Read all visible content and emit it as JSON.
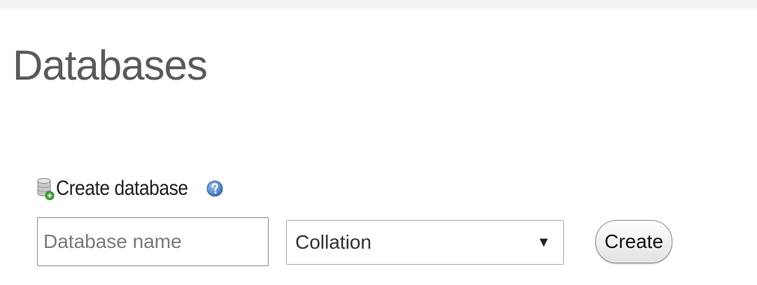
{
  "page": {
    "title": "Databases"
  },
  "create_section": {
    "heading": "Create database",
    "db_icon": "database-add-icon",
    "help_icon": "help-icon"
  },
  "form": {
    "name_input": {
      "value": "",
      "placeholder": "Database name"
    },
    "collation_select": {
      "selected": "Collation",
      "arrow_icon": "dropdown-arrow-icon"
    },
    "create_button_label": "Create"
  },
  "colors": {
    "title": "#5a5a5a",
    "help_blue": "#4a7fc1",
    "add_green": "#3fa535"
  }
}
